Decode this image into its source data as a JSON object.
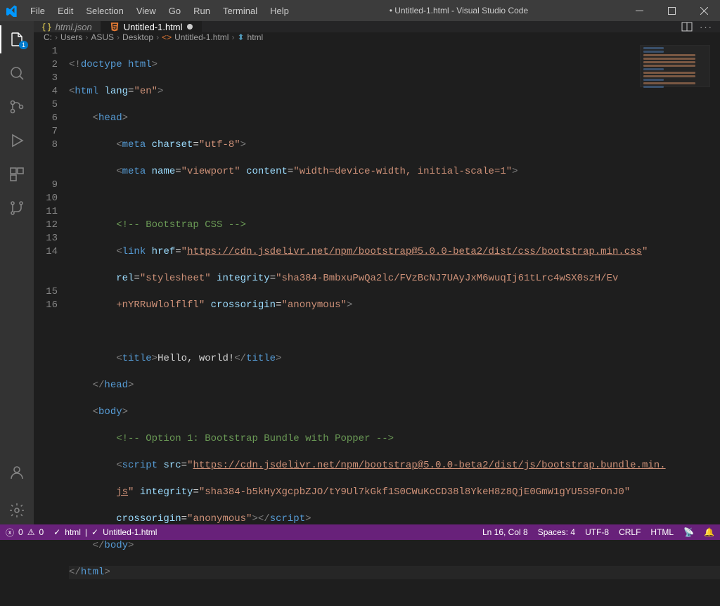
{
  "window": {
    "title": "• Untitled-1.html - Visual Studio Code"
  },
  "menubar": [
    "File",
    "Edit",
    "Selection",
    "View",
    "Go",
    "Run",
    "Terminal",
    "Help"
  ],
  "activitybar": {
    "explorer_badge": "1"
  },
  "tabs": [
    {
      "label": "html.json",
      "icon": "json"
    },
    {
      "label": "Untitled-1.html",
      "icon": "html",
      "modified": true
    }
  ],
  "breadcrumbs": [
    "C:",
    "Users",
    "ASUS",
    "Desktop",
    "Untitled-1.html",
    "html"
  ],
  "line_numbers": [
    "1",
    "2",
    "3",
    "4",
    "5",
    "6",
    "7",
    "8",
    "",
    "",
    "9",
    "10",
    "11",
    "12",
    "13",
    "14",
    "",
    "",
    "15",
    "16"
  ],
  "code": {
    "l1": {
      "doctype": "doctype",
      "html": "html"
    },
    "l2": {
      "tag": "html",
      "attr": "lang",
      "val": "\"en\""
    },
    "l3": {
      "tag": "head"
    },
    "l4": {
      "tag": "meta",
      "attr": "charset",
      "val": "\"utf-8\""
    },
    "l5": {
      "tag": "meta",
      "name": "name",
      "name_v": "\"viewport\"",
      "content": "content",
      "content_v": "\"width=device-width, initial-scale=1\""
    },
    "l7": "<!-- Bootstrap CSS -->",
    "l8a": {
      "tag": "link",
      "href": "href",
      "url": "https://cdn.jsdelivr.net/npm/bootstrap@5.0.0-beta2/dist/css/bootstrap.min.css"
    },
    "l8b": {
      "rel": "rel",
      "rel_v": "\"stylesheet\"",
      "integ": "integrity",
      "integ_v": "\"sha384-BmbxuPwQa2lc/FVzBcNJ7UAyJxM6wuqIj61tLrc4wSX0szH/Ev"
    },
    "l8c": {
      "cont": "+nYRRuWlolflfl\"",
      "co": "crossorigin",
      "co_v": "\"anonymous\""
    },
    "l10": {
      "open": "title",
      "text": "Hello, world!",
      "close": "title"
    },
    "l11": {
      "tag": "head"
    },
    "l12": {
      "tag": "body"
    },
    "l13": "<!-- Option 1: Bootstrap Bundle with Popper -->",
    "l14a": {
      "tag": "script",
      "src": "src",
      "url": "https://cdn.jsdelivr.net/npm/bootstrap@5.0.0-beta2/dist/js/bootstrap.bundle.min."
    },
    "l14b": {
      "url2": "js",
      "integ": "integrity",
      "integ_v": "\"sha384-b5kHyXgcpbZJO/tY9Ul7kGkf1S0CWuKcCD38l8YkeH8z8QjE0GmW1gYU5S9FOnJ0\""
    },
    "l14c": {
      "co": "crossorigin",
      "co_v": "\"anonymous\"",
      "close": "script"
    },
    "l15": {
      "tag": "body"
    },
    "l16": {
      "tag": "html"
    }
  },
  "statusbar": {
    "errors": "0",
    "warnings": "0",
    "lang_check": "html",
    "file_check": "Untitled-1.html",
    "position": "Ln 16, Col 8",
    "spaces": "Spaces: 4",
    "encoding": "UTF-8",
    "eol": "CRLF",
    "language": "HTML"
  }
}
